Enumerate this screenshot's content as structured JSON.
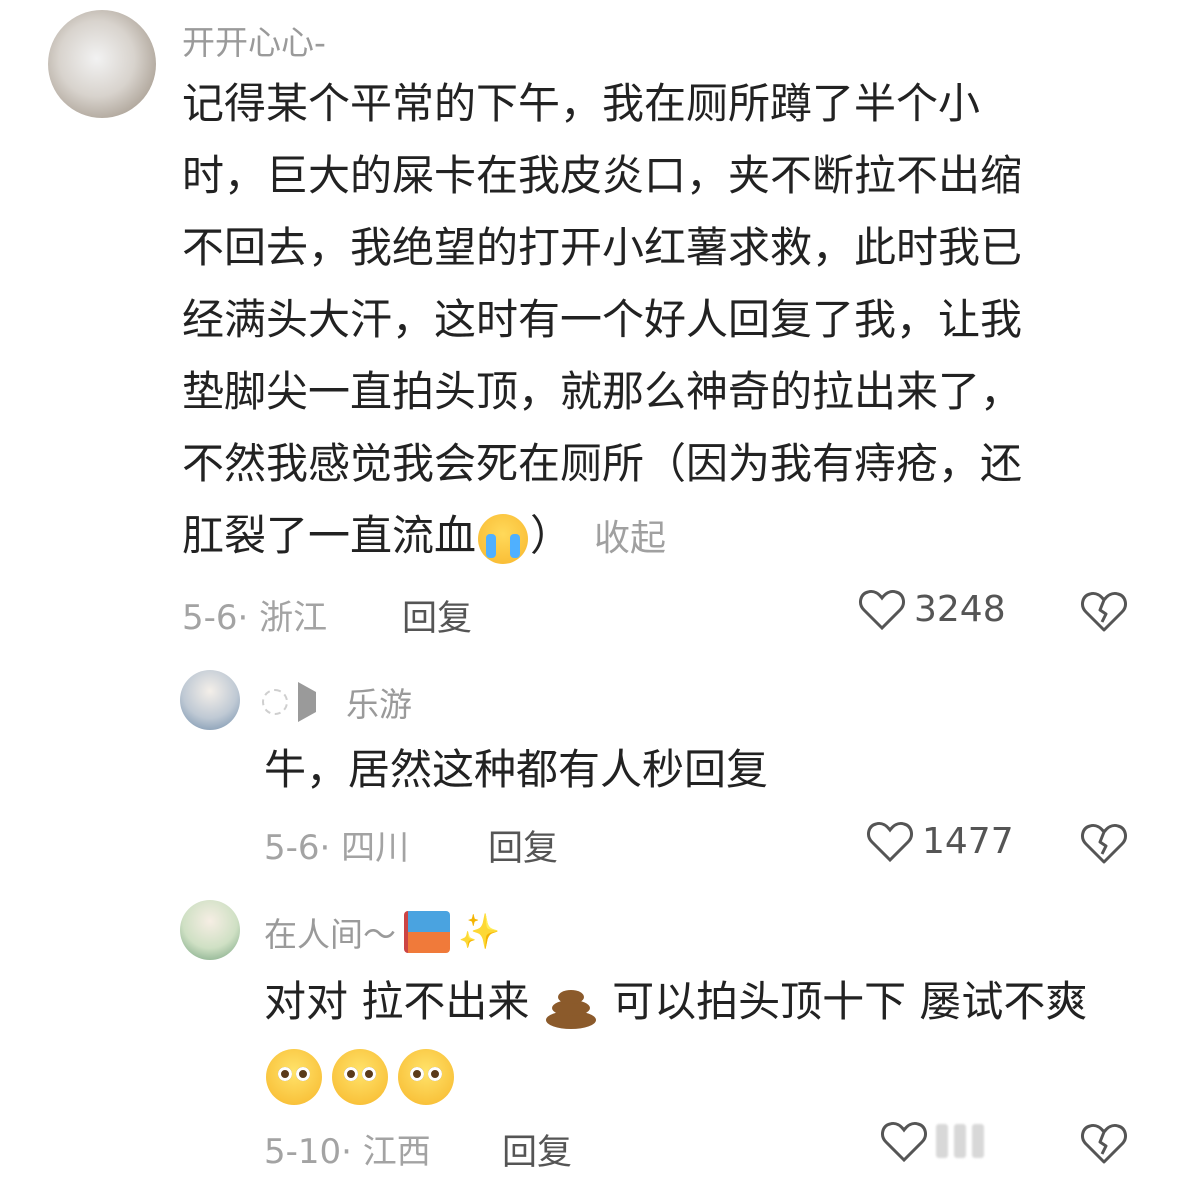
{
  "main_comment": {
    "username": "开开心心-",
    "lines": [
      "记得某个平常的下午，我在厕所蹲了半个小",
      "时，巨大的屎卡在我皮炎口，夹不断拉不出缩",
      "不回去，我绝望的打开小红薯求救，此时我已",
      "经满头大汗，这时有一个好人回复了我，让我",
      "垫脚尖一直拍头顶，就那么神奇的拉出来了，",
      "不然我感觉我会死在厕所（因为我有痔疮，还",
      "肛裂了一直流血"
    ],
    "last_line_end": "）",
    "collapse_label": "收起",
    "meta": "5-6· 浙江",
    "reply_label": "回复",
    "likes": "3248"
  },
  "reply1": {
    "username": "乐游",
    "text": "牛，居然这种都有人秒回复",
    "meta": "5-6· 四川",
    "reply_label": "回复",
    "likes": "1477"
  },
  "reply2": {
    "username": "在人间～",
    "text_part1": "对对 拉不出来",
    "text_part2": "可以拍头顶十下 屡试不爽",
    "meta": "5-10· 江西",
    "reply_label": "回复"
  },
  "icons": {
    "like": "heart-outline-icon",
    "dislike": "broken-heart-icon",
    "collapse": "collapse-text"
  },
  "colors": {
    "text_primary": "#222222",
    "text_secondary": "#9a9a9a",
    "reply_link": "#555555"
  }
}
